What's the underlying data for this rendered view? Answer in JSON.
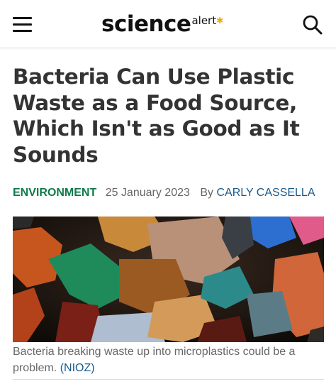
{
  "header": {
    "menu_icon": "hamburger-menu-icon",
    "logo_main": "science",
    "logo_sub": "alert",
    "logo_star": "✱",
    "search_icon": "search-icon",
    "accent_color": "#f2a900"
  },
  "article": {
    "headline": "Bacteria Can Use Plastic Waste as a Food Source, Which Isn't as Good as It Sounds",
    "category": "ENVIRONMENT",
    "category_color": "#0f7a4a",
    "date": "25 January 2023",
    "by_label": "By",
    "author": "CARLY CASSELLA",
    "author_color": "#1a5a8a",
    "caption_text": "Bacteria breaking waste up into microplastics could be a problem.",
    "caption_credit": "(NIOZ)"
  }
}
